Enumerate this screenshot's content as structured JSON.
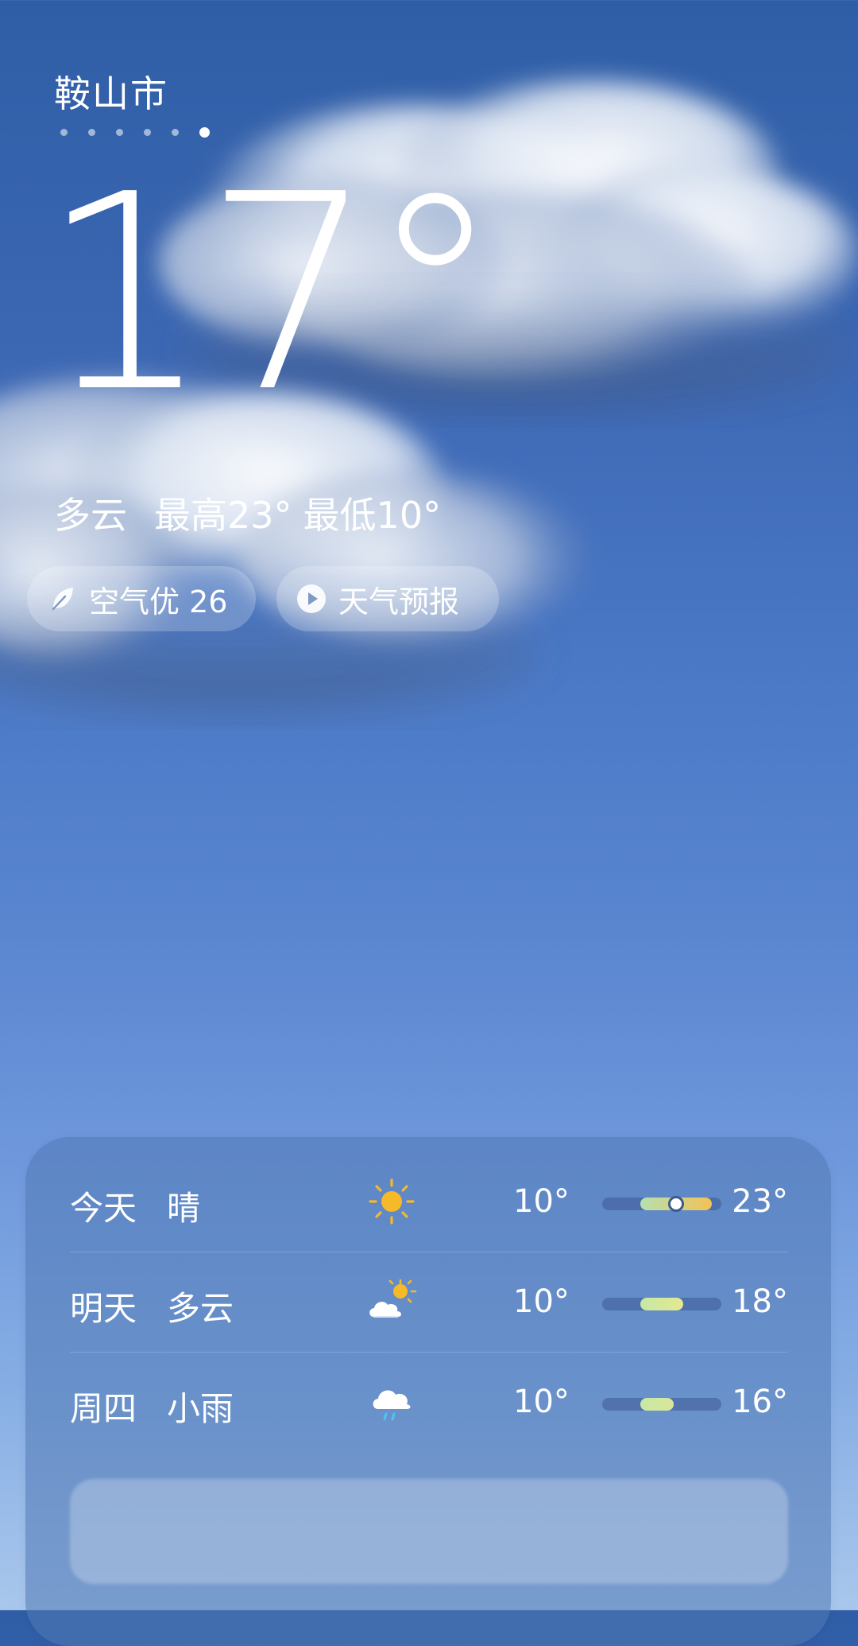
{
  "header": {
    "city": "鞍山市",
    "page_dots_count": 6,
    "active_dot_index": 5
  },
  "current": {
    "temperature": "17°",
    "condition": "多云",
    "high_text": "最高23°",
    "low_text": "最低10°"
  },
  "pills": {
    "aqi_label": "空气优 26",
    "aqi_icon": "leaf-icon",
    "forecast_label": "天气预报",
    "forecast_icon": "play-icon"
  },
  "forecast": {
    "rows": [
      {
        "day": "今天",
        "condition": "晴",
        "icon": "sun-icon",
        "low": "10°",
        "high": "23°",
        "bar_start_fraction": 0.32,
        "bar_end_fraction": 0.92,
        "current_marker_fraction": 0.62,
        "bar_color_start": "#b6e0b0",
        "bar_color_end": "#f2c255"
      },
      {
        "day": "明天",
        "condition": "多云",
        "icon": "partly-cloudy-icon",
        "low": "10°",
        "high": "18°",
        "bar_start_fraction": 0.32,
        "bar_end_fraction": 0.68,
        "bar_color_start": "#c6e8a6",
        "bar_color_end": "#e4e98f"
      },
      {
        "day": "周四",
        "condition": "小雨",
        "icon": "light-rain-icon",
        "low": "10°",
        "high": "16°",
        "bar_start_fraction": 0.32,
        "bar_end_fraction": 0.6,
        "bar_color_start": "#c6e8a6",
        "bar_color_end": "#dbe69a"
      }
    ]
  },
  "colors": {
    "sun": "#f6b928",
    "rain": "#4fc3f7"
  }
}
